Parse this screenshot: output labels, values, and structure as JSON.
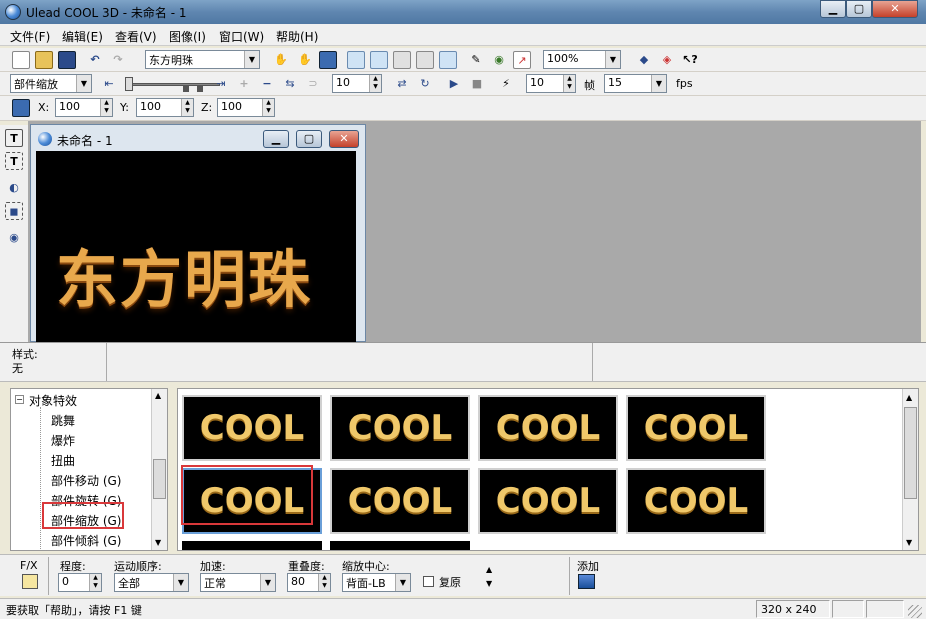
{
  "window": {
    "title": "Ulead COOL 3D - 未命名 - 1"
  },
  "menu": [
    "文件(F)",
    "编辑(E)",
    "查看(V)",
    "图像(I)",
    "窗口(W)",
    "帮助(H)"
  ],
  "toolbar1": {
    "font_name": "东方明珠",
    "zoom": "100%"
  },
  "toolbar2": {
    "effect": "部件缩放",
    "spin1": "10",
    "spin2": "10",
    "frames_label": "帧",
    "frames": "15",
    "fps_label": "fps"
  },
  "toolbar3": {
    "x_label": "X:",
    "x": "100",
    "y_label": "Y:",
    "y": "100",
    "z_label": "Z:",
    "z": "100"
  },
  "document": {
    "title": "未命名 - 1",
    "text": "东方明珠"
  },
  "style": {
    "label": "样式:",
    "value": "无"
  },
  "tree": {
    "root": "对象特效",
    "items": [
      "跳舞",
      "爆炸",
      "扭曲",
      "部件移动 (G)",
      "部件旋转 (G)",
      "部件缩放 (G)",
      "部件倾斜 (G)"
    ],
    "selected": "部件缩放 (G)"
  },
  "gallery": {
    "thumbs": [
      "COOL",
      "COOL",
      "COOL",
      "COOL",
      "COOL",
      "COOL",
      "COOL",
      "COOL"
    ]
  },
  "bottom": {
    "fx": "F/X",
    "degree_label": "程度:",
    "degree": "0",
    "order_label": "运动顺序:",
    "order": "全部",
    "accel_label": "加速:",
    "accel": "正常",
    "overlap_label": "重叠度:",
    "overlap": "80",
    "center_label": "缩放中心:",
    "center": "背面-LB",
    "restore_label": "复原",
    "add_label": "添加"
  },
  "status": {
    "help": "要获取「帮助」，请按 F1 键",
    "size": "320 x 240"
  },
  "colors": {
    "highlight": "#d9383a",
    "text_gold": "#e8a84c"
  }
}
